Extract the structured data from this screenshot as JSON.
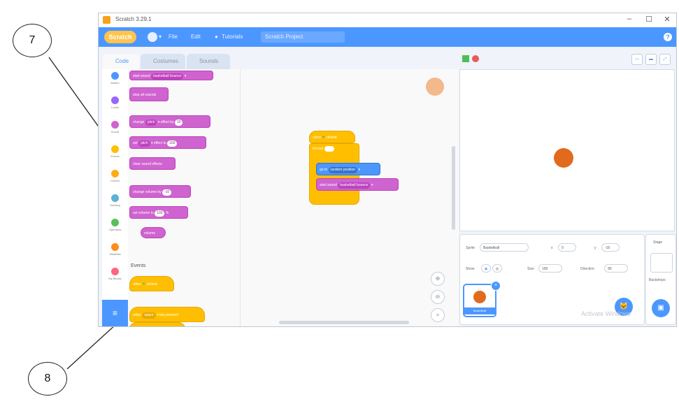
{
  "window": {
    "title": "Scratch 3.29.1",
    "controls": {
      "minimize": "–",
      "maximize": "☐",
      "close": "✕"
    }
  },
  "menubar": {
    "logo": "Scratch",
    "file": "File",
    "edit": "Edit",
    "tutorials": "Tutorials",
    "project_title": "Scratch Project",
    "help": "?"
  },
  "tabs": {
    "code": "Code",
    "costumes": "Costumes",
    "sounds": "Sounds"
  },
  "categories": [
    {
      "label": "Motion",
      "color": "#4c97ff"
    },
    {
      "label": "Looks",
      "color": "#9966ff"
    },
    {
      "label": "Sound",
      "color": "#cf63cf"
    },
    {
      "label": "Events",
      "color": "#ffbf00"
    },
    {
      "label": "Control",
      "color": "#ffab19"
    },
    {
      "label": "Sensing",
      "color": "#5cb1d6"
    },
    {
      "label": "Operators",
      "color": "#59c059"
    },
    {
      "label": "Variables",
      "color": "#ff8c1a"
    },
    {
      "label": "My Blocks",
      "color": "#ff6680"
    }
  ],
  "palette": {
    "start_sound": "start sound",
    "sound_name": "basketball bounce",
    "stop_all_sounds": "stop all sounds",
    "change_effect": "change",
    "pitch": "pitch",
    "effect_by": "effect by",
    "change_val": "10",
    "set_effect": "set",
    "effect_to": "effect to",
    "set_val": "100",
    "clear_effects": "clear sound effects",
    "change_volume": "change volume by",
    "change_volume_val": "-10",
    "set_volume": "set volume to",
    "set_volume_val": "100",
    "percent": "%",
    "volume": "volume",
    "events_heading": "Events",
    "when_flag": "when",
    "clicked": "clicked",
    "when_key": "when",
    "key_space": "space",
    "key_pressed": "key pressed"
  },
  "script": {
    "when": "when",
    "clicked": "clicked",
    "forever": "forever",
    "glide_to": "go to",
    "random_position": "random position",
    "start_sound": "start sound",
    "sound_name": "basketball bounce"
  },
  "sprite_info": {
    "sprite_label": "Sprite",
    "sprite_name": "Basketball",
    "x_label": "x",
    "x_value": "0",
    "y_label": "y",
    "y_value": "-16",
    "show_label": "Show",
    "size_label": "Size",
    "size_value": "100",
    "direction_label": "Direction",
    "direction_value": "90",
    "selected_sprite": "Basketball"
  },
  "stage_panel": {
    "label": "Stage",
    "backdrops": "Backdrops"
  },
  "watermark": "Activate Windows",
  "callouts": {
    "seven": "7",
    "eight": "8"
  }
}
